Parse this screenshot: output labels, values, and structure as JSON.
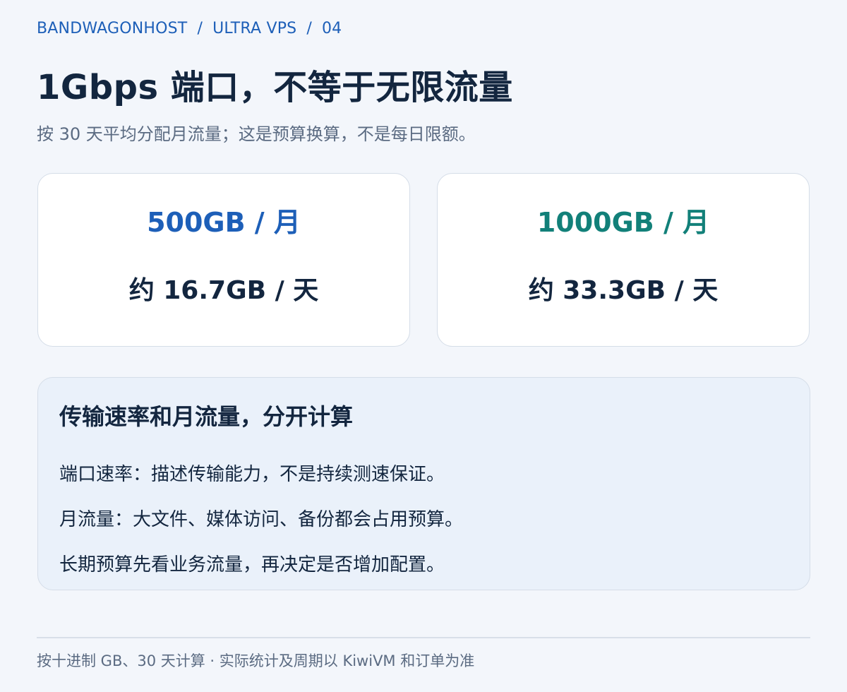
{
  "breadcrumb": {
    "items": [
      "BANDWAGONHOST",
      "ULTRA VPS",
      "04"
    ],
    "separator": "/"
  },
  "title": "1Gbps 端口，不等于无限流量",
  "subtitle": "按 30 天平均分配月流量；这是预算换算，不是每日限额。",
  "cards": [
    {
      "monthly": "500GB / 月",
      "daily": "约 16.7GB / 天",
      "accent": "#1d5fb8"
    },
    {
      "monthly": "1000GB / 月",
      "daily": "约 33.3GB / 天",
      "accent": "#128079"
    }
  ],
  "info": {
    "heading": "传输速率和月流量，分开计算",
    "lines": [
      "端口速率：描述传输能力，不是持续测速保证。",
      "月流量：大文件、媒体访问、备份都会占用预算。",
      "长期预算先看业务流量，再决定是否增加配置。"
    ]
  },
  "footer": "按十进制 GB、30 天计算 · 实际统计及周期以 KiwiVM 和订单为准"
}
